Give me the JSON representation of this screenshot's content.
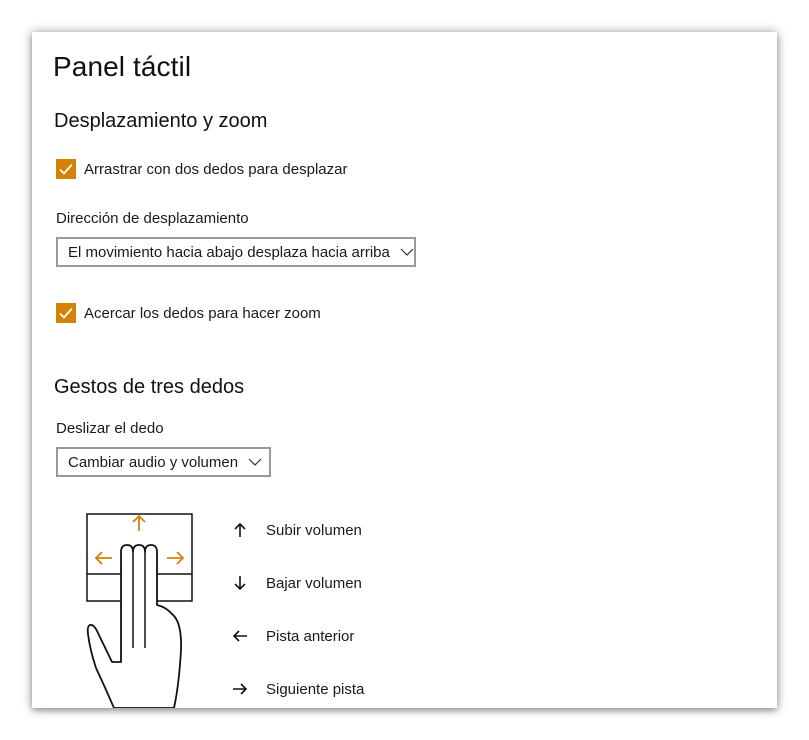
{
  "page": {
    "title": "Panel táctil"
  },
  "scroll_zoom": {
    "heading": "Desplazamiento y zoom",
    "two_finger_scroll": {
      "label": "Arrastrar con dos dedos para desplazar",
      "checked": true
    },
    "scroll_direction": {
      "label": "Dirección de desplazamiento",
      "value": "El movimiento hacia abajo desplaza hacia arriba"
    },
    "pinch_zoom": {
      "label": "Acercar los dedos para hacer zoom",
      "checked": true
    }
  },
  "three_finger": {
    "heading": "Gestos de tres dedos",
    "swipe": {
      "label": "Deslizar el dedo",
      "value": "Cambiar audio y volumen"
    },
    "gestures": [
      {
        "icon": "arrow-up-icon",
        "label": "Subir volumen"
      },
      {
        "icon": "arrow-down-icon",
        "label": "Bajar volumen"
      },
      {
        "icon": "arrow-left-icon",
        "label": "Pista anterior"
      },
      {
        "icon": "arrow-right-icon",
        "label": "Siguiente pista"
      }
    ]
  },
  "colors": {
    "accent": "#d4820a",
    "select_border": "#999999"
  }
}
